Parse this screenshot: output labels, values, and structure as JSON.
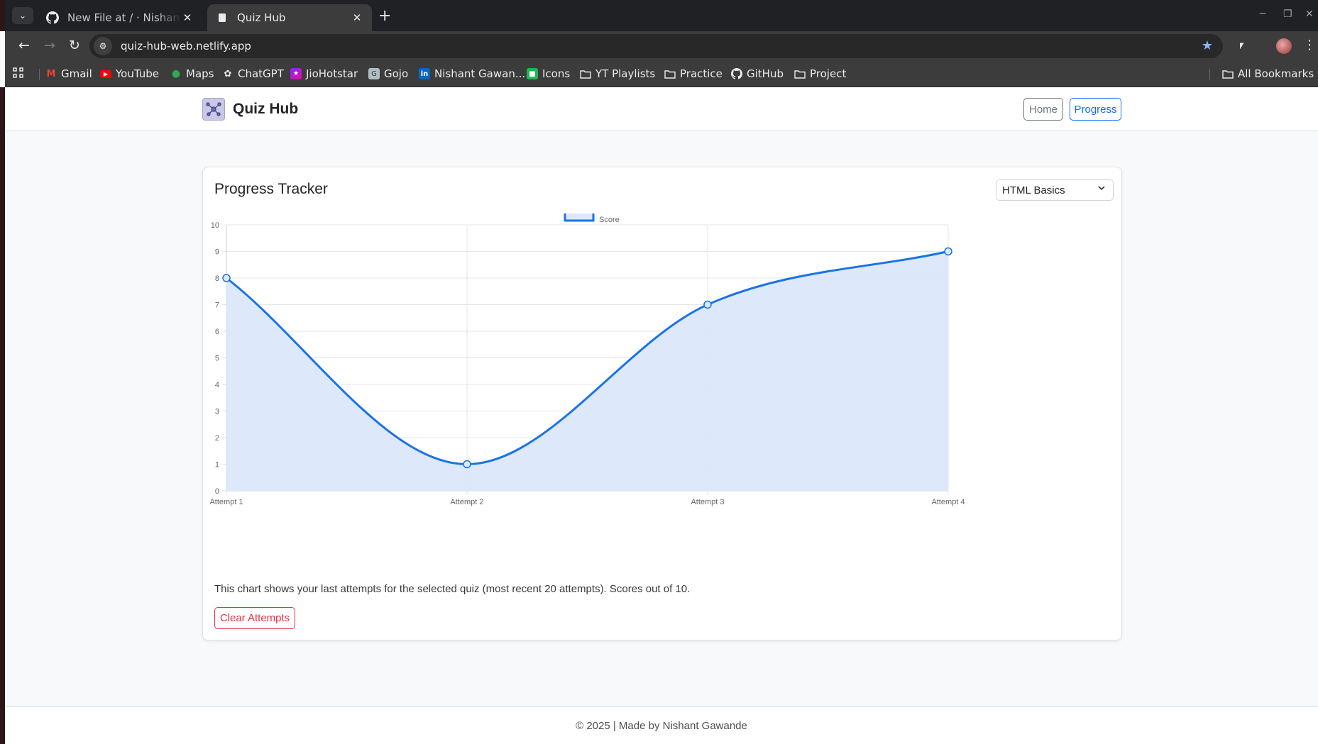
{
  "browser": {
    "tabs": [
      {
        "title": "New File at / · Nishantsgawande/Quiz-Hub",
        "active": false,
        "icon": "github-icon"
      },
      {
        "title": "Quiz Hub",
        "active": true,
        "icon": "page-icon"
      }
    ],
    "url": "quiz-hub-web.netlify.app",
    "bookmarks": [
      {
        "label": "Gmail",
        "icon": "gmail-icon"
      },
      {
        "label": "YouTube",
        "icon": "youtube-icon"
      },
      {
        "label": "Maps",
        "icon": "maps-icon"
      },
      {
        "label": "ChatGPT",
        "icon": "chatgpt-icon"
      },
      {
        "label": "JioHotstar",
        "icon": "jiohotstar-icon"
      },
      {
        "label": "Gojo",
        "icon": "gojo-icon"
      },
      {
        "label": "Nishant Gawan...",
        "icon": "linkedin-icon"
      },
      {
        "label": "Icons",
        "icon": "icons-icon"
      },
      {
        "label": "YT Playlists",
        "icon": "folder-icon"
      },
      {
        "label": "Practice",
        "icon": "folder-icon"
      },
      {
        "label": "GitHub",
        "icon": "github-icon"
      },
      {
        "label": "Project",
        "icon": "folder-icon"
      }
    ],
    "all_bookmarks": "All Bookmarks"
  },
  "nav": {
    "brand": "Quiz Hub",
    "home": "Home",
    "progress": "Progress"
  },
  "card": {
    "title": "Progress Tracker",
    "selected_quiz": "HTML Basics",
    "note": "This chart shows your last attempts for the selected quiz (most recent 20 attempts). Scores out of 10.",
    "clear_button": "Clear Attempts"
  },
  "footer": {
    "text": "© 2025 | Made by Nishant Gawande"
  },
  "colors": {
    "accent": "#0d6efd",
    "danger": "#dc3545",
    "line": "#1a73e8",
    "fill": "#dbe8fb"
  },
  "chart_data": {
    "type": "line",
    "categories": [
      "Attempt 1",
      "Attempt 2",
      "Attempt 3",
      "Attempt 4"
    ],
    "series": [
      {
        "name": "Score",
        "values": [
          8,
          1,
          7,
          9
        ],
        "fill": true
      }
    ],
    "ylim": [
      0,
      10
    ],
    "yticks": [
      0,
      1,
      2,
      3,
      4,
      5,
      6,
      7,
      8,
      9,
      10
    ],
    "legend": "top-center",
    "grid": true
  }
}
